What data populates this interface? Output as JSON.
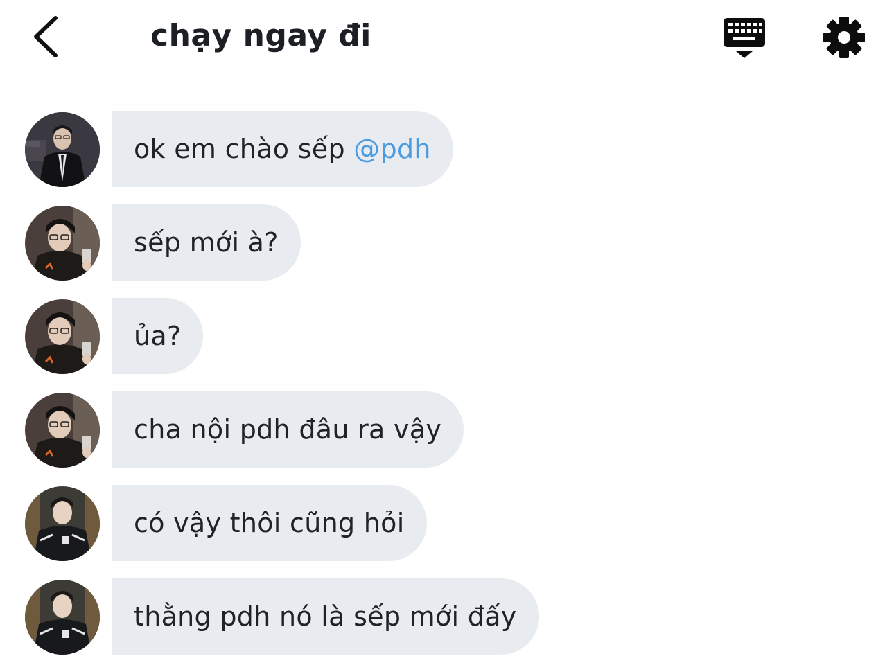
{
  "header": {
    "title": "chạy ngay đi",
    "back_icon": "chevron-left-icon",
    "keyboard_icon": "keyboard-hide-icon",
    "settings_icon": "gear-icon"
  },
  "colors": {
    "bubble_bg": "#e8ebf0",
    "mention": "#4a9be0",
    "text": "#1f2328"
  },
  "messages": [
    {
      "text": "ok em chào sếp ",
      "mention": "@pdh",
      "avatar": "avatar-suit"
    },
    {
      "text": "sếp mới à?",
      "mention": "",
      "avatar": "avatar-glasses"
    },
    {
      "text": "ủa?",
      "mention": "",
      "avatar": "avatar-glasses"
    },
    {
      "text": "cha nội pdh đâu ra vậy",
      "mention": "",
      "avatar": "avatar-glasses"
    },
    {
      "text": "có vậy thôi cũng hỏi",
      "mention": "",
      "avatar": "avatar-jacket"
    },
    {
      "text": "thằng pdh nó là sếp mới đấy",
      "mention": "",
      "avatar": "avatar-jacket"
    }
  ]
}
